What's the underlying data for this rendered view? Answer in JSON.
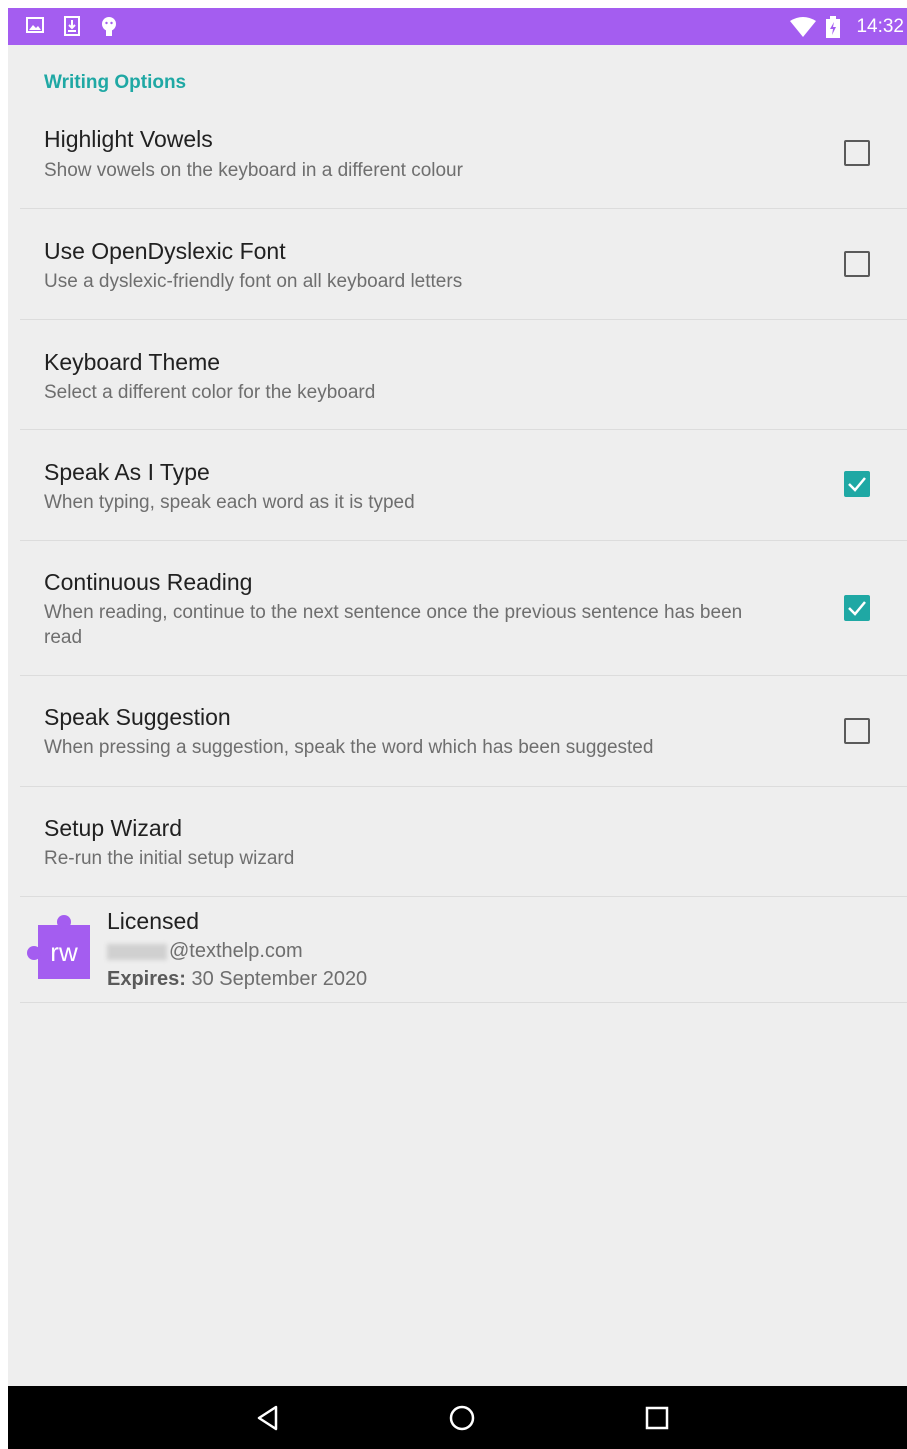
{
  "status_bar": {
    "time": "14:32",
    "left_icons": [
      "image-icon",
      "download-icon",
      "android-debug-icon"
    ],
    "right_icons": [
      "wifi-icon",
      "battery-charging-icon"
    ],
    "color": "#a45df0"
  },
  "section": {
    "header": "Writing Options",
    "accent": "#1fa8a4"
  },
  "prefs": [
    {
      "title": "Highlight Vowels",
      "summary": "Show vowels on the keyboard in a different colour",
      "checked": false
    },
    {
      "title": "Use OpenDyslexic Font",
      "summary": "Use a dyslexic-friendly font on all keyboard letters",
      "checked": false
    },
    {
      "title": "Keyboard Theme",
      "summary": "Select a different color for the keyboard"
    },
    {
      "title": "Speak As I Type",
      "summary": "When typing, speak each word as it is typed",
      "checked": true
    },
    {
      "title": "Continuous Reading",
      "summary": "When reading, continue to the next sentence once the previous sentence has been read",
      "checked": true
    },
    {
      "title": "Speak Suggestion",
      "summary": "When pressing a suggestion, speak the word which has been suggested",
      "checked": false
    },
    {
      "title": "Setup Wizard",
      "summary": "Re-run the initial setup wizard"
    }
  ],
  "license": {
    "icon_text": "rw",
    "title": "Licensed",
    "email_domain": "@texthelp.com",
    "expires_label": "Expires:",
    "expires_value": "30 September 2020",
    "icon_color": "#a45df0"
  },
  "nav": {
    "icons": [
      "back-icon",
      "home-icon",
      "recents-icon"
    ]
  }
}
